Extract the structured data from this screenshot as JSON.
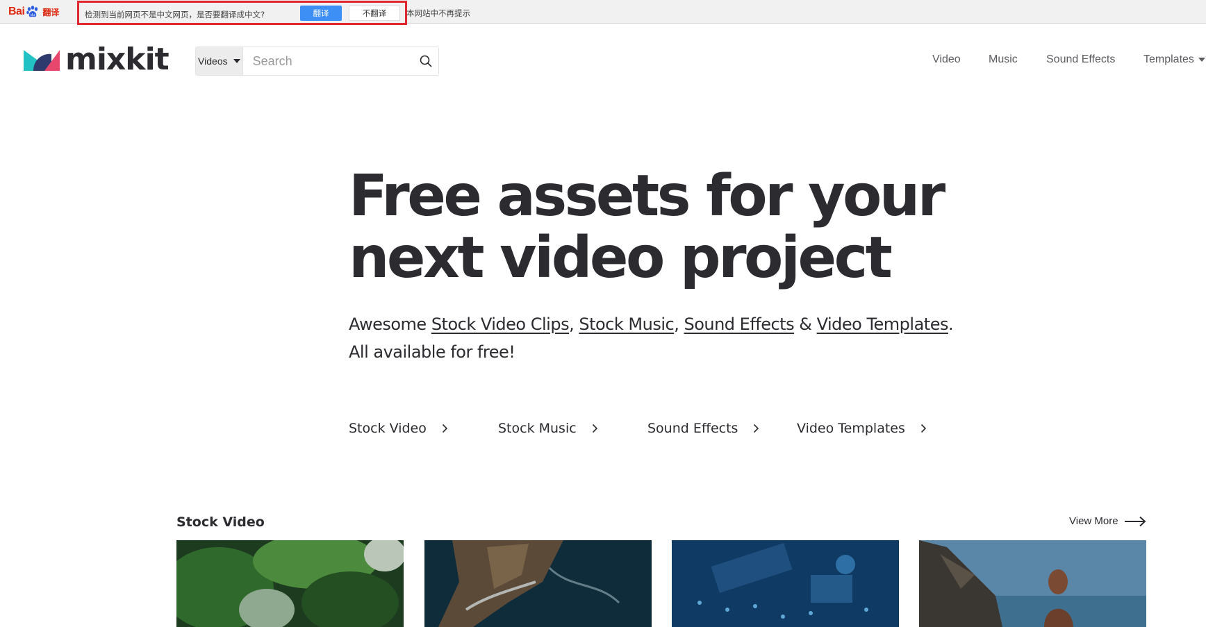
{
  "translate_bar": {
    "brand": "Bai",
    "brand_suffix": "翻译",
    "message": "检测到当前网页不是中文网页，是否要翻译成中文?",
    "translate_label": "翻译",
    "no_translate_label": "不翻译",
    "never_label": "本网站中不再提示"
  },
  "header": {
    "logo_text": "mixkit",
    "search": {
      "type_label": "Videos",
      "placeholder": "Search",
      "value": ""
    },
    "nav": [
      "Video",
      "Music",
      "Sound Effects",
      "Templates"
    ]
  },
  "hero": {
    "title_line1": "Free assets for your",
    "title_line2": "next video project",
    "sub_prefix": "Awesome ",
    "link_stock_video_clips": "Stock Video Clips",
    "sep1": ", ",
    "link_stock_music": "Stock Music",
    "sep2": ", ",
    "link_sound_effects": "Sound Effects",
    "sep3": " & ",
    "link_video_templates": "Video Templates",
    "sep4": ".",
    "line2": "All available for free!"
  },
  "categories": [
    "Stock Video",
    "Stock Music",
    "Sound Effects",
    "Video Templates"
  ],
  "section": {
    "title": "Stock Video",
    "view_more": "View More"
  },
  "colors": {
    "text": "#2b2b30",
    "accent_blue": "#3d8ef5",
    "highlight_red": "#e0262f",
    "logo_teal": "#22c1c3",
    "logo_pink": "#e8476d",
    "logo_navy": "#2e3a6e"
  }
}
